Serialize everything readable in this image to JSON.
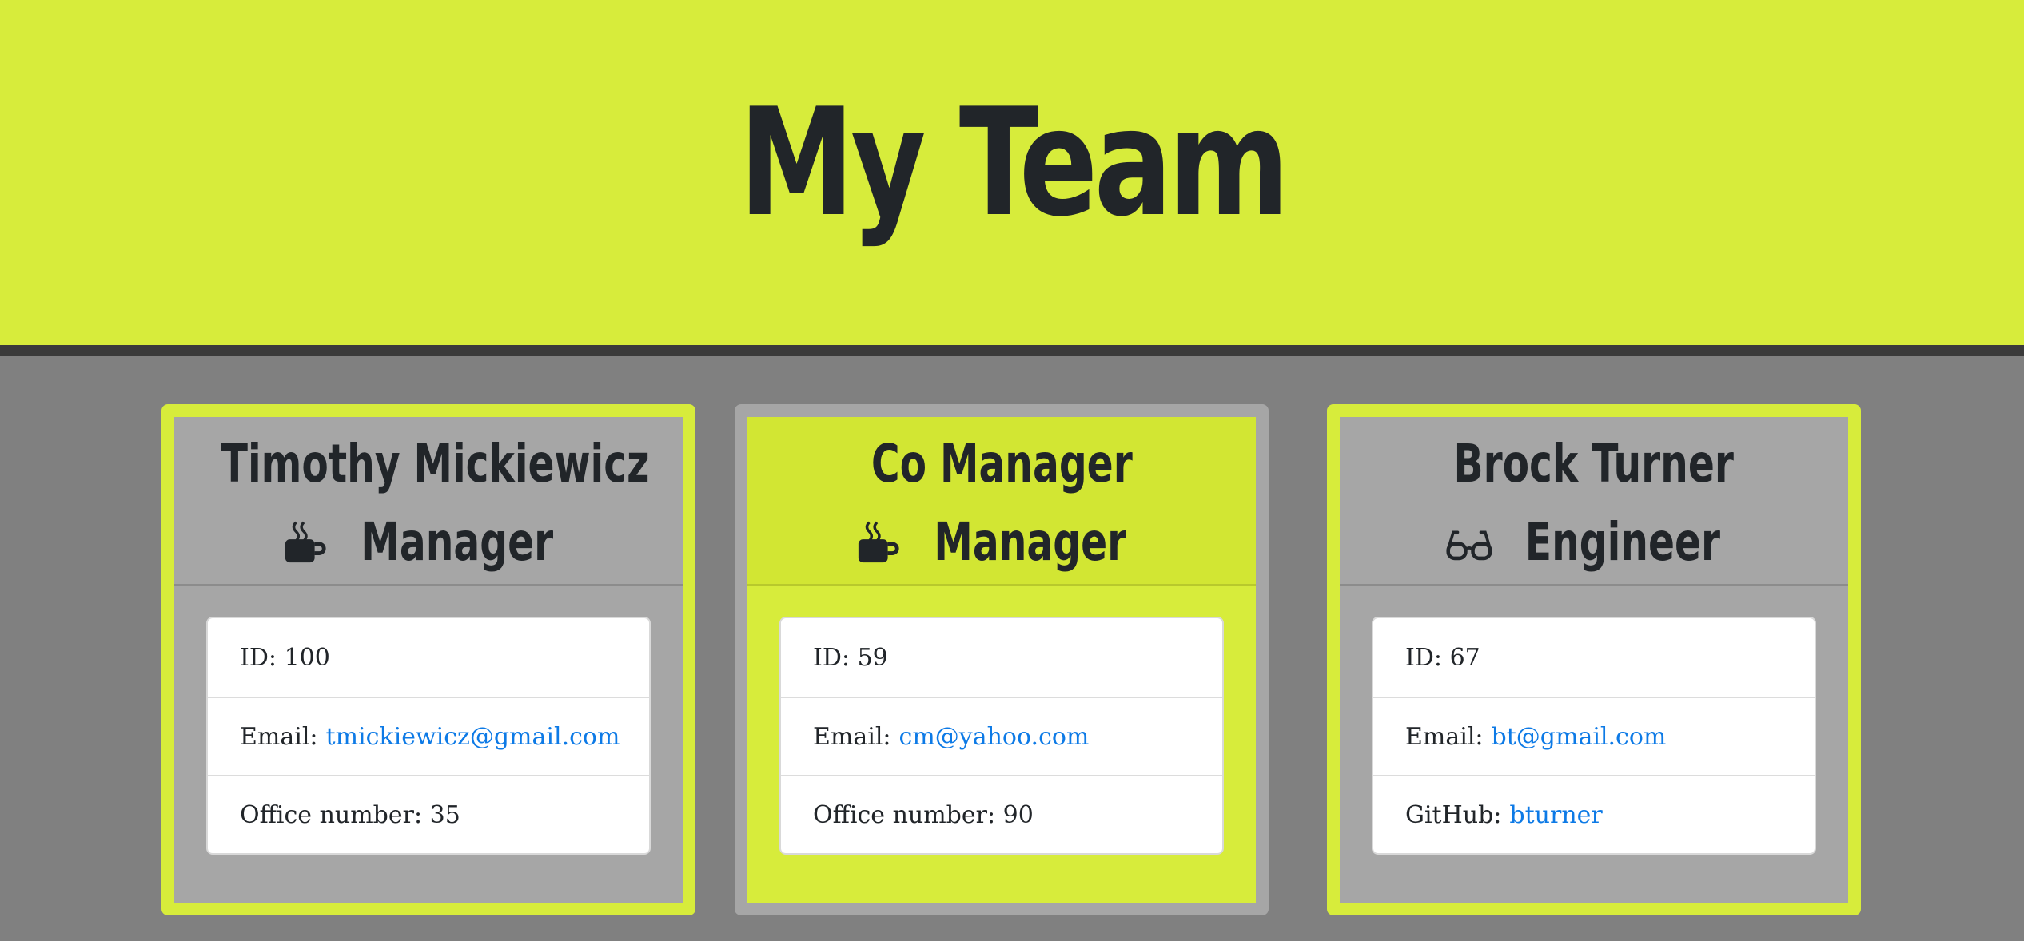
{
  "header": {
    "title": "My Team"
  },
  "colors": {
    "accent": "#d7ec3b",
    "card_gray": "#a6a6a6",
    "link": "#0d7ae6",
    "background": "#808080"
  },
  "cards": [
    {
      "name": "Timothy Mickiewicz",
      "role": "Manager",
      "role_icon": "coffee-mug-icon",
      "id_label": "ID:",
      "id": "100",
      "email_label": "Email:",
      "email": "tmickiewicz@gmail.com",
      "extra_label": "Office number:",
      "extra": "35"
    },
    {
      "name": "Co Manager",
      "role": "Manager",
      "role_icon": "coffee-mug-icon",
      "id_label": "ID:",
      "id": "59",
      "email_label": "Email:",
      "email": "cm@yahoo.com",
      "extra_label": "Office number:",
      "extra": "90"
    },
    {
      "name": "Brock Turner",
      "role": "Engineer",
      "role_icon": "glasses-icon",
      "id_label": "ID:",
      "id": "67",
      "email_label": "Email:",
      "email": "bt@gmail.com",
      "extra_label": "GitHub:",
      "extra": "bturner"
    }
  ]
}
